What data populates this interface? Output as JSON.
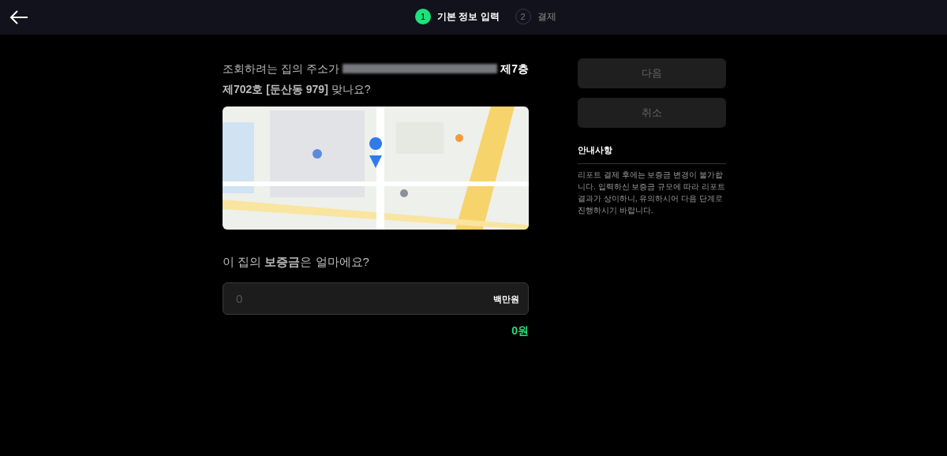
{
  "steps": [
    {
      "number": "1",
      "label": "기본 정보 입력",
      "selected": true
    },
    {
      "number": "2",
      "label": "결제",
      "selected": false
    }
  ],
  "address_question": {
    "prefix": "조회하려는 집의 주소가",
    "floor": "제7층",
    "suffix": "**제702호 [둔산동 979]** 맞나요?"
  },
  "deposit_question": "이 집의 **보증금**은 얼마에요?",
  "deposit_field": {
    "placeholder": "0",
    "unit": "백만원"
  },
  "deposit_amount": "0원",
  "buttons": [
    {
      "label": "다음",
      "disabled": true
    },
    {
      "label": "취소",
      "disabled": true
    }
  ],
  "notice": {
    "title": "안내사항",
    "body": "리포트 결제 후에는 보증금 변경이 불가합니다. 입력하신 보증금 규모에 따라 리포트 결과가 상이하니, 유의하시어 다음 단계로 진행하시기 바랍니다."
  }
}
